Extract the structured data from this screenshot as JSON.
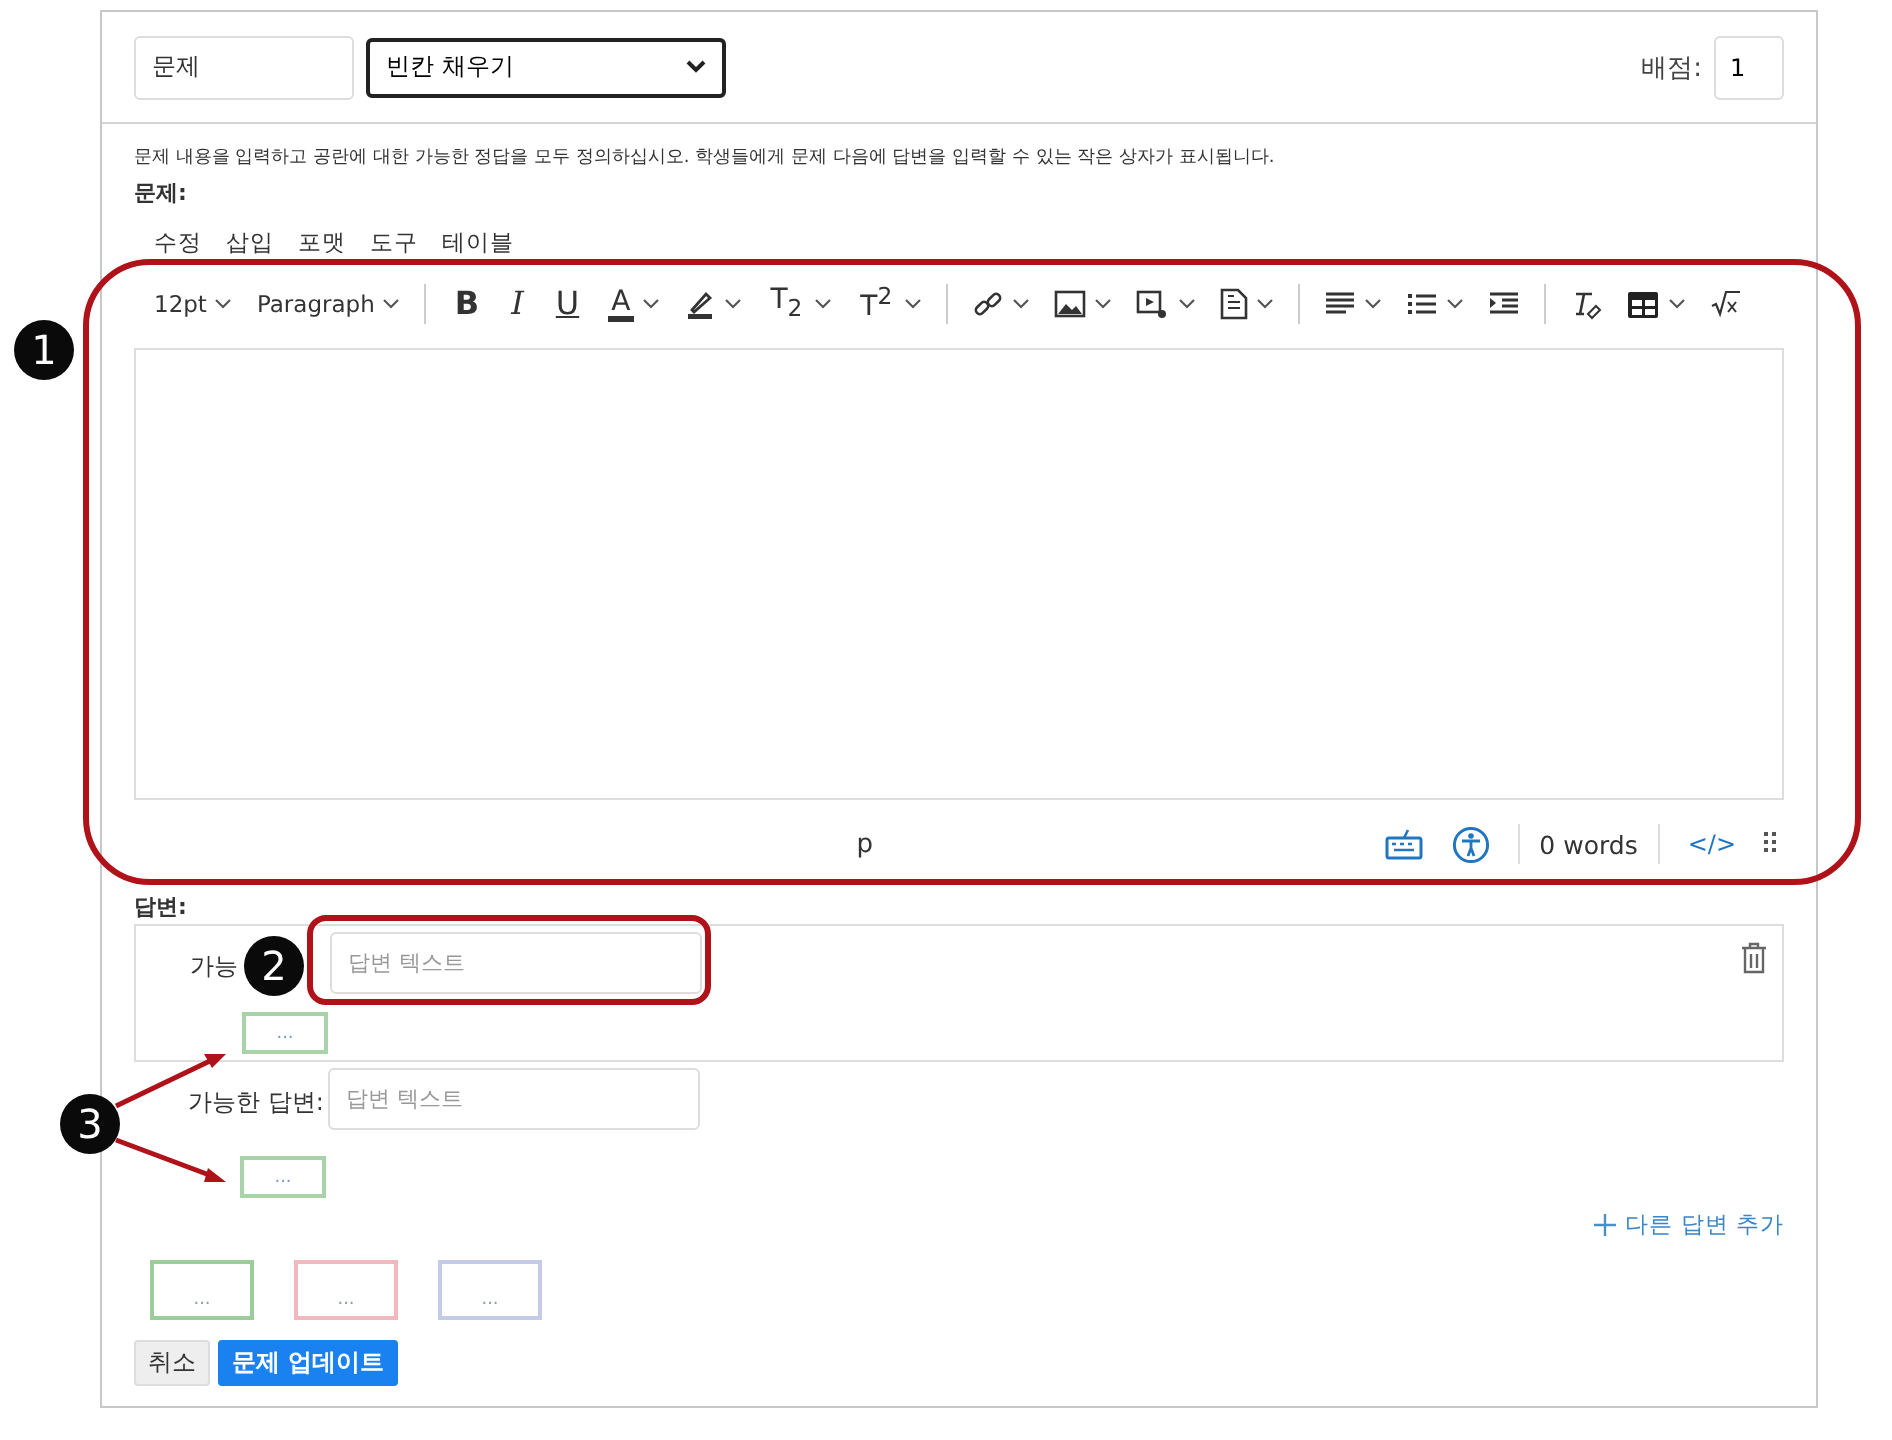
{
  "question_header": {
    "title_value": "문제",
    "type_value": "빈칸 채우기",
    "points_label": "배점:",
    "points_value": "1"
  },
  "instructions": "문제 내용을 입력하고 공란에 대한 가능한 정답을 모두 정의하십시오. 학생들에게 문제 다음에 답변을 입력할 수 있는 작은 상자가 표시됩니다.",
  "question_label": "문제:",
  "editor": {
    "menus": [
      "수정",
      "삽입",
      "포맷",
      "도구",
      "테이블"
    ],
    "toolbar": [
      {
        "kind": "dropdown",
        "label": "12pt"
      },
      {
        "kind": "dropdown",
        "label": "Paragraph"
      },
      {
        "kind": "separator"
      },
      {
        "kind": "bold",
        "label": "B"
      },
      {
        "kind": "italic",
        "label": "I"
      },
      {
        "kind": "underline",
        "label": "U"
      },
      {
        "kind": "color",
        "label": "A"
      },
      {
        "kind": "highlighter"
      },
      {
        "kind": "script",
        "label": "T$_{2}$"
      },
      {
        "kind": "script",
        "label": "T$^{2}$"
      },
      {
        "kind": "separator"
      },
      {
        "kind": "link"
      },
      {
        "kind": "image"
      },
      {
        "kind": "media"
      },
      {
        "kind": "document"
      },
      {
        "kind": "separator"
      },
      {
        "kind": "align"
      },
      {
        "kind": "list"
      },
      {
        "kind": "indent"
      },
      {
        "kind": "separator"
      },
      {
        "kind": "clear"
      },
      {
        "kind": "table"
      },
      {
        "kind": "math"
      }
    ],
    "path": "p",
    "word_count": "0 words",
    "code_toggle": "</>"
  },
  "answers_label": "답변:",
  "answer_card": {
    "label": "가능",
    "placeholder": "답변 텍스트",
    "marker": "..."
  },
  "answers": [
    {
      "label": "가능한 답변:",
      "placeholder": "답변 텍스트",
      "marker": "..."
    }
  ],
  "add_answer": "다른 답변 추가",
  "legend": [
    {
      "text": "...",
      "color": "#9acd9a"
    },
    {
      "text": "...",
      "color": "#f3b8bd"
    },
    {
      "text": "...",
      "color": "#c3cbe6"
    }
  ],
  "buttons": [
    {
      "label": "취소",
      "kind": "secondary"
    },
    {
      "label": "문제 업데이트",
      "kind": "primary"
    }
  ],
  "callouts": [
    {
      "number": "1"
    },
    {
      "number": "2"
    },
    {
      "number": "3"
    }
  ]
}
